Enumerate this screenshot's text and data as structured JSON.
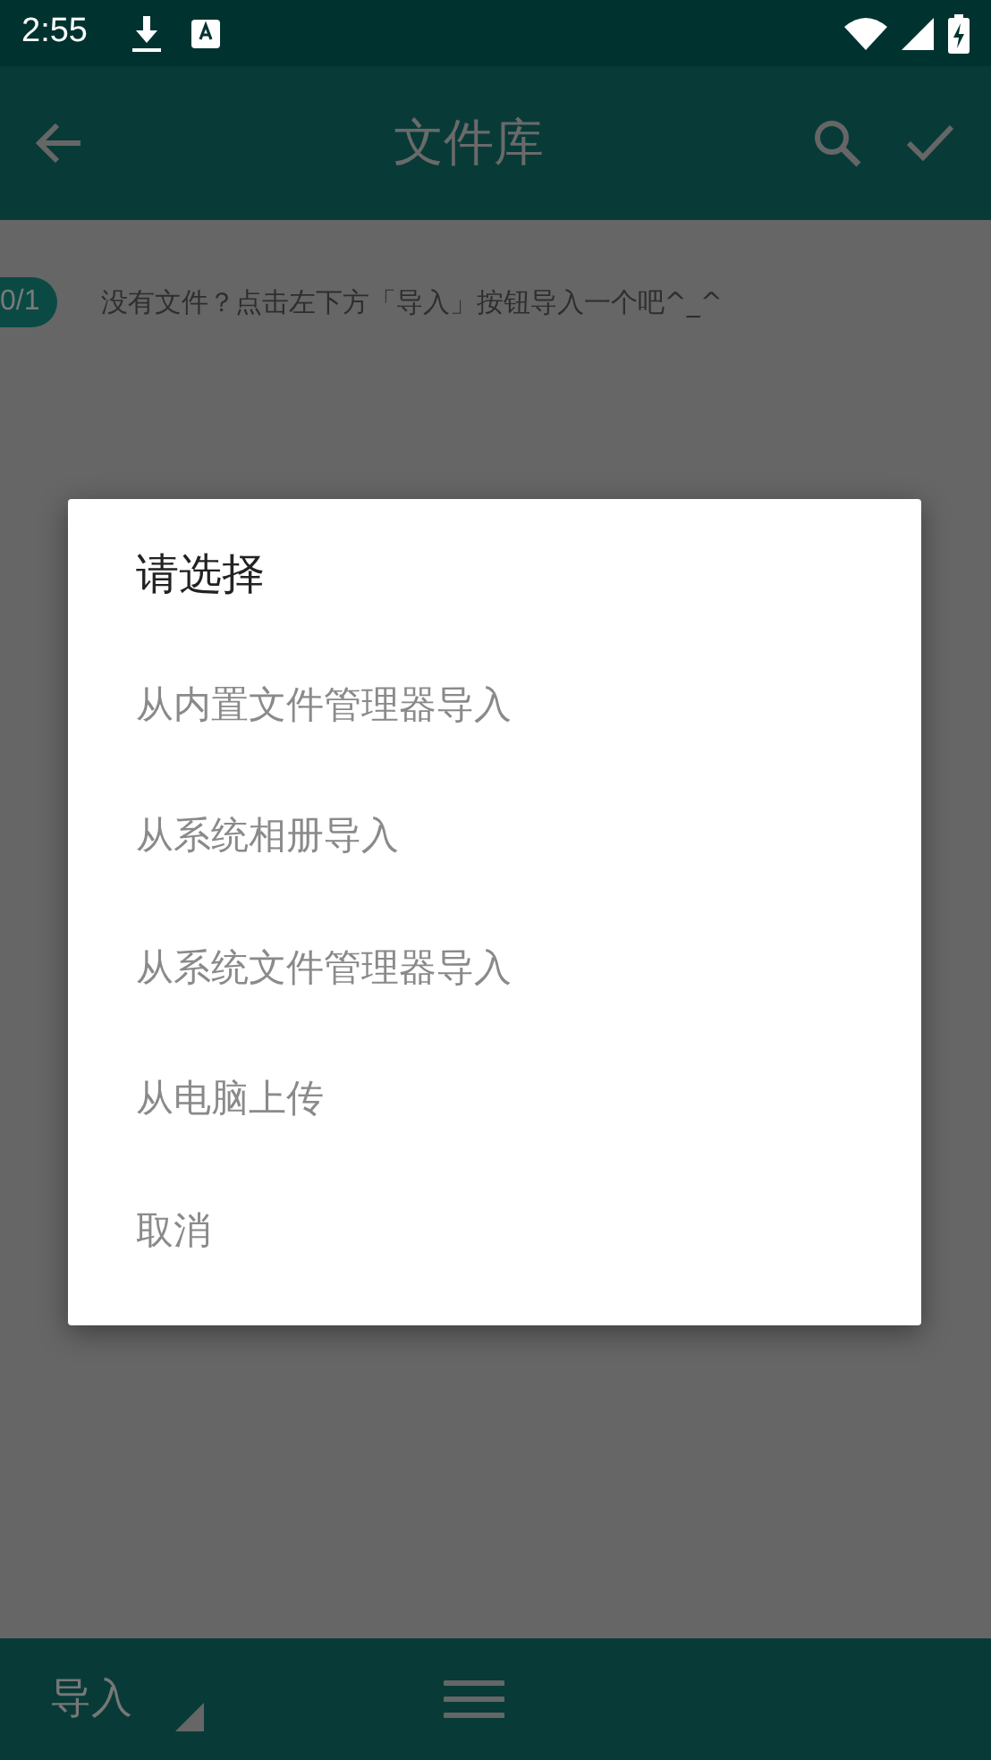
{
  "status_bar": {
    "time": "2:55"
  },
  "toolbar": {
    "title": "文件库"
  },
  "content": {
    "counter": "0/1",
    "hint": "没有文件？点击左下方「导入」按钮导入一个吧^_^"
  },
  "dialog": {
    "title": "请选择",
    "options": [
      {
        "label": "从内置文件管理器导入"
      },
      {
        "label": "从系统相册导入"
      },
      {
        "label": "从系统文件管理器导入"
      },
      {
        "label": "从电脑上传"
      },
      {
        "label": "取消"
      }
    ]
  },
  "bottom_bar": {
    "import_label": "导入"
  }
}
